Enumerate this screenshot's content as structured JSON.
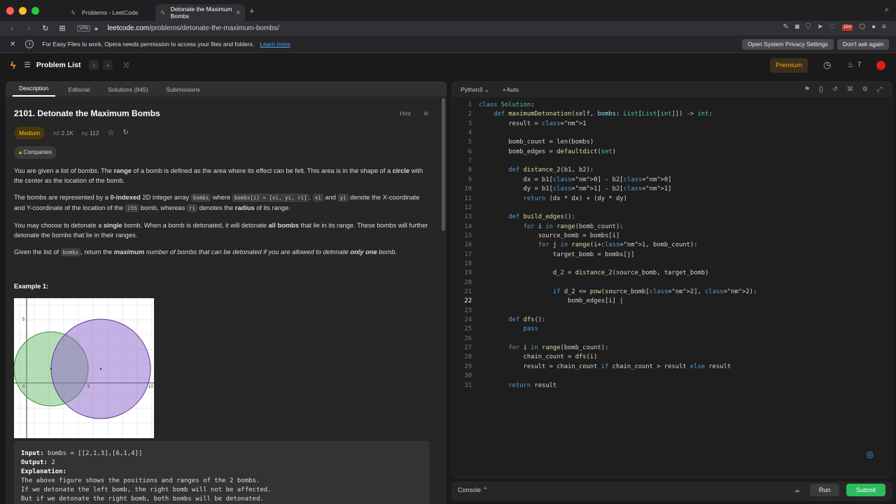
{
  "browser": {
    "tabs": [
      {
        "label": "Problems - LeetCode"
      },
      {
        "label": "Detonate the Maximum Bombs"
      }
    ],
    "url_domain": "leetcode.com",
    "url_path": "/problems/detonate-the-maximum-bombs/",
    "vpn_label": "VPN",
    "badge": "15m"
  },
  "infobar": {
    "message": "For Easy Files to work, Opera needs permission to access your files and folders.",
    "learn_more": "Learn more",
    "button_privacy": "Open System Privacy Settings",
    "button_dismiss": "Don't ask again"
  },
  "header": {
    "problem_list": "Problem List",
    "premium": "Premium",
    "streak": "7"
  },
  "left_tabs": [
    "Description",
    "Editorial",
    "Solutions (845)",
    "Submissions"
  ],
  "problem": {
    "title": "2101. Detonate the Maximum Bombs",
    "hint": "Hint",
    "difficulty": "Medium",
    "likes": "2.1K",
    "dislikes": "112",
    "companies": "Companies",
    "p1_a": "You are given a list of bombs. The ",
    "p1_b": "range",
    "p1_c": " of a bomb is defined as the area where its effect can be felt. This area is in the shape of a ",
    "p1_d": "circle",
    "p1_e": " with the center as the location of the bomb.",
    "p2_a": "The bombs are represented by a ",
    "p2_b": "0-indexed",
    "p2_c": " 2D integer array ",
    "p2_code1": "bombs",
    "p2_d": " where ",
    "p2_code2": "bombs[i] = [xi, yi, ri]",
    "p2_e": ". ",
    "p2_code3": "xi",
    "p2_f": " and ",
    "p2_code4": "yi",
    "p2_g": " denote the X-coordinate and Y-coordinate of the location of the ",
    "p2_code5": "ith",
    "p2_h": " bomb, whereas ",
    "p2_code6": "ri",
    "p2_i": " denotes the ",
    "p2_j": "radius",
    "p2_k": " of its range.",
    "p3_a": "You may choose to detonate a ",
    "p3_b": "single",
    "p3_c": " bomb. When a bomb is detonated, it will detonate ",
    "p3_d": "all bombs",
    "p3_e": " that lie in its range. These bombs will further detonate the bombs that lie in their ranges.",
    "p4_a": "Given the list of ",
    "p4_code": "bombs",
    "p4_b": ", return the ",
    "p4_c": "maximum",
    "p4_d": " number of bombs that can be detonated if you are allowed to detonate ",
    "p4_e": "only one",
    "p4_f": " bomb.",
    "example_title": "Example 1:",
    "fig_label_5": "5",
    "fig_label_0a": "0",
    "fig_label_5b": "5",
    "fig_label_10": "10",
    "ex_input_label": "Input:",
    "ex_input": " bombs = [[2,1,3],[6,1,4]]",
    "ex_output_label": "Output:",
    "ex_output": " 2",
    "ex_expl_label": "Explanation:",
    "ex_expl1": "The above figure shows the positions and ranges of the 2 bombs.",
    "ex_expl2": "If we detonate the left bomb, the right bomb will not be affected.",
    "ex_expl3": "But if we detonate the right bomb, both bombs will be detonated."
  },
  "editor": {
    "language": "Python3",
    "mode": "Auto",
    "current_line": 22,
    "lines": [
      "class Solution:",
      "    def maximumDetonation(self, bombs: List[List[int]]) -> int:",
      "        result = 1",
      "",
      "        bomb_count = len(bombs)",
      "        bomb_edges = defaultdict(set)",
      "",
      "        def distance_2(b1, b2):",
      "            dx = b1[0] - b2[0]",
      "            dy = b1[1] - b2[1]",
      "            return (dx * dx) + (dy * dy)",
      "",
      "        def build_edges():",
      "            for i in range(bomb_count):",
      "                source_bomb = bombs[i]",
      "                for j in range(i+1, bomb_count):",
      "                    target_bomb = bombs[j]",
      "",
      "                    d_2 = distance_2(source_bomb, target_bomb)",
      "",
      "                    if d_2 <= pow(source_bomb[2], 2):",
      "                        bomb_edges[i] |",
      "",
      "        def dfs():",
      "            pass",
      "",
      "        for i in range(bomb_count):",
      "            chain_count = dfs(i)",
      "            result = chain_count if chain_count > result else result",
      "",
      "        return result"
    ]
  },
  "console": {
    "label": "Console",
    "run": "Run",
    "submit": "Submit"
  }
}
